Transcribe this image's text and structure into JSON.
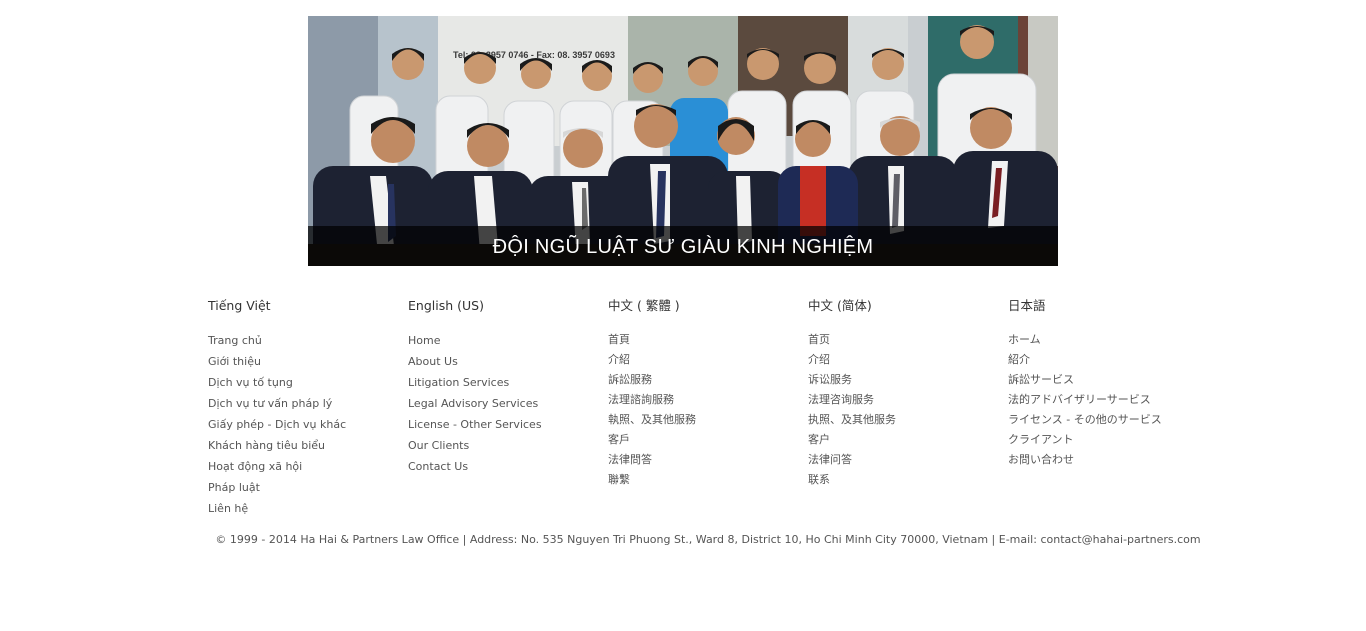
{
  "banner": {
    "caption": "ĐỘI NGŨ LUẬT SƯ GIÀU KINH NGHIỆM",
    "sign_text": "Tel: 08. 3957 0746 - Fax: 08. 3957 0693"
  },
  "columns": [
    {
      "heading": "Tiếng Việt",
      "items": [
        "Trang chủ",
        "Giới thiệu",
        "Dịch vụ tố tụng",
        "Dịch vụ tư vấn pháp lý",
        "Giấy phép - Dịch vụ khác",
        "Khách hàng tiêu biểu",
        "Hoạt động xã hội",
        "Pháp luật",
        "Liên hệ"
      ]
    },
    {
      "heading": "English (US)",
      "items": [
        "Home",
        "About Us",
        "Litigation Services",
        "Legal Advisory Services",
        "License - Other Services",
        "Our Clients",
        "Contact Us"
      ]
    },
    {
      "heading": "中文 ( 繁體 )",
      "items": [
        "首頁",
        "介紹",
        "訴訟服務",
        "法理諮詢服務",
        "執照、及其他服務",
        "客戶",
        "法律問答",
        "聯繫"
      ]
    },
    {
      "heading": "中文 (简体)",
      "items": [
        "首页",
        "介绍",
        "诉讼服务",
        "法理咨询服务",
        "执照、及其他服务",
        "客户",
        "法律问答",
        "联系"
      ]
    },
    {
      "heading": "日本語",
      "items": [
        "ホーム",
        "紹介",
        "訴訟サービス",
        "法的アドバイザリーサービス",
        "ライセンス - その他のサービス",
        "クライアント",
        "お問い合わせ"
      ]
    }
  ],
  "copyright": "© 1999 - 2014 Ha Hai & Partners Law Office | Address: No. 535 Nguyen Tri Phuong St., Ward 8, District 10, Ho Chi Minh City 70000, Vietnam | E-mail: contact@hahai-partners.com"
}
